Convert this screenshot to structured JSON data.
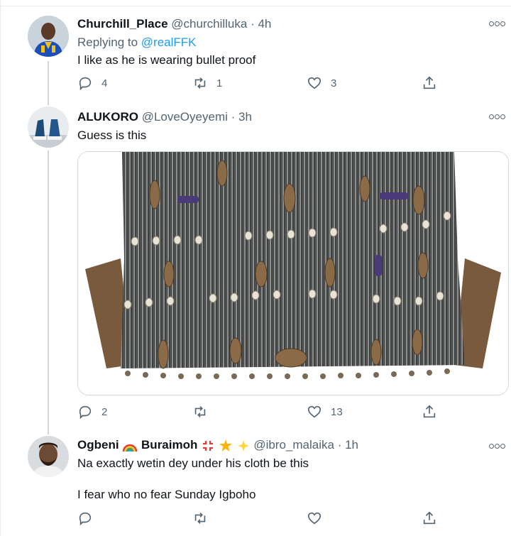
{
  "tweets": [
    {
      "name": "Churchill_Place",
      "handle": "@churchilluka",
      "dot": "·",
      "time": "4h",
      "replying_label": "Replying to",
      "replying_mention": "@realFFK",
      "text": "I like as he is wearing bullet proof",
      "replies": "4",
      "retweets": "1",
      "likes": "3"
    },
    {
      "name": "ALUKORO",
      "handle": "@LoveOyeyemi",
      "dot": "·",
      "time": "3h",
      "text": "Guess is this",
      "replies": "2",
      "retweets": "",
      "likes": "13"
    },
    {
      "name_part1": "Ogbeni",
      "name_part2": "Buraimoh",
      "handle": "@ibro_malaika",
      "dot": "·",
      "time": "1h",
      "text_line1": "Na exactly wetin dey under his cloth be this",
      "text_line2": "I fear who no fear Sunday Igboho",
      "replies": "",
      "retweets": "",
      "likes": ""
    }
  ],
  "icons": {
    "reply": "reply-icon",
    "retweet": "retweet-icon",
    "like": "heart-icon",
    "share": "share-icon",
    "more": "more-icon"
  },
  "colors": {
    "link": "#1d9bf0",
    "secondary": "#536471",
    "thread_line": "#cfd9de"
  }
}
